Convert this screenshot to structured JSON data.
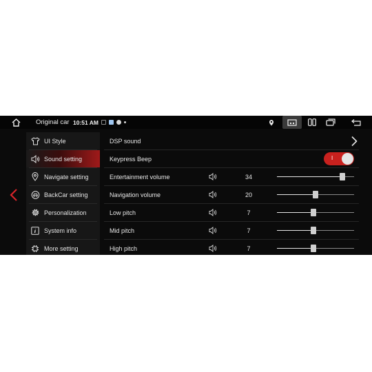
{
  "status_bar": {
    "car_name": "Original car",
    "time": "10:51 AM",
    "notification_colors": [
      "#8f8f8f",
      "#9fc6f0",
      "#d8d8d8"
    ]
  },
  "menu": {
    "items": [
      {
        "label": "UI Style",
        "icon": "shirt-icon"
      },
      {
        "label": "Sound setting",
        "icon": "speaker-icon",
        "active": true
      },
      {
        "label": "Navigate setting",
        "icon": "location-pin-icon"
      },
      {
        "label": "BackCar setting",
        "icon": "car-icon"
      },
      {
        "label": "Personalization",
        "icon": "gear-icon"
      },
      {
        "label": "System info",
        "icon": "info-icon"
      },
      {
        "label": "More setting",
        "icon": "chip-icon"
      }
    ]
  },
  "settings": {
    "dsp_sound": {
      "label": "DSP sound"
    },
    "keypress_beep": {
      "label": "Keypress Beep",
      "toggle_on_label": "I",
      "enabled": true
    },
    "sliders": [
      {
        "label": "Entertainment volume",
        "value": "34",
        "fraction": 0.85
      },
      {
        "label": "Navigation volume",
        "value": "20",
        "fraction": 0.5
      },
      {
        "label": "Low pitch",
        "value": "7",
        "fraction": 0.47
      },
      {
        "label": "Mid pitch",
        "value": "7",
        "fraction": 0.47
      },
      {
        "label": "High pitch",
        "value": "7",
        "fraction": 0.47
      }
    ]
  },
  "colors": {
    "accent": "#c8211e",
    "back_arrow": "#d8242a",
    "background": "#0b0b0b",
    "menu_background": "#171717"
  }
}
